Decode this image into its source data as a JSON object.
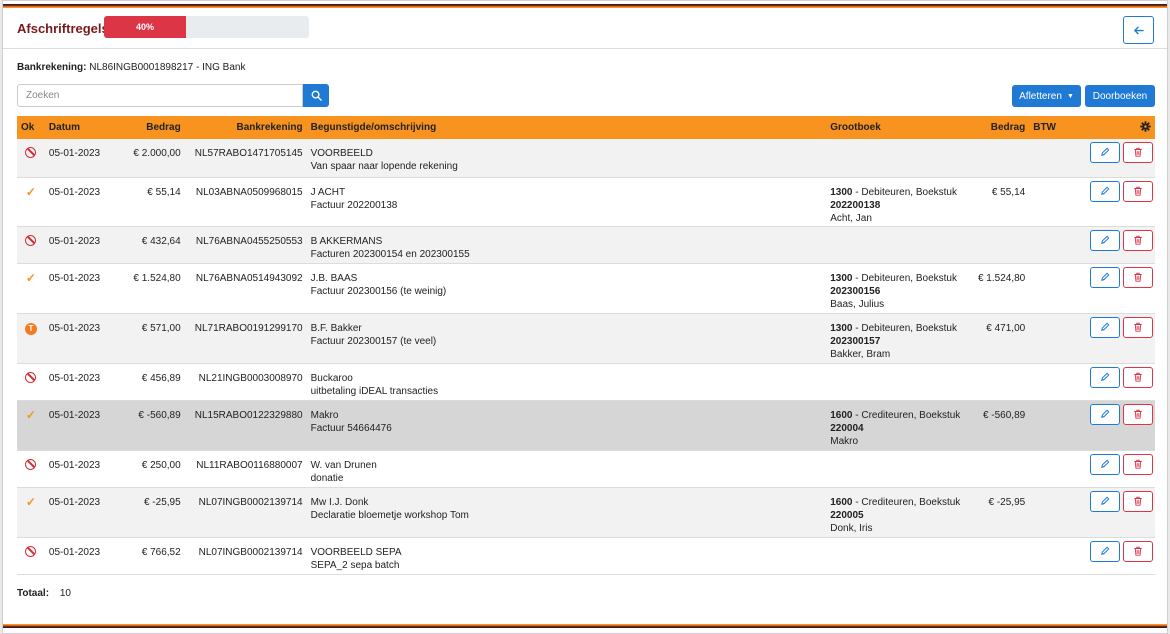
{
  "header": {
    "title": "Afschriftregels",
    "progress_label": "40%",
    "progress_value": 0.4,
    "back_icon": "arrow-left-icon"
  },
  "bank": {
    "label": "Bankrekening:",
    "value": "NL86INGB0001898217 - ING Bank"
  },
  "search": {
    "placeholder": "Zoeken",
    "value": ""
  },
  "toolbar": {
    "afletteren_label": "Afletteren",
    "doorboeken_label": "Doorboeken"
  },
  "table": {
    "headers": {
      "ok": "Ok",
      "datum": "Datum",
      "bedrag": "Bedrag",
      "bankrekening": "Bankrekening",
      "begunstigde": "Begunstigde/omschrijving",
      "grootboek": "Grootboek",
      "gb_bedrag": "Bedrag",
      "btw": "BTW"
    },
    "rows": [
      {
        "status": "blocked",
        "datum": "05-01-2023",
        "bedrag": "€ 2.000,00",
        "bankrekening": "NL57RABO1471705145",
        "naam": "VOORBEELD",
        "omschrijving": "Van spaar naar lopende rekening",
        "gb_code": "",
        "gb_naam": "",
        "gb_ref": "",
        "gb_relatie": "",
        "gb_bedrag": ""
      },
      {
        "status": "ok",
        "datum": "05-01-2023",
        "bedrag": "€ 55,14",
        "bankrekening": "NL03ABNA0509968015",
        "naam": "J ACHT",
        "omschrijving": "Factuur 202200138",
        "gb_code": "1300",
        "gb_naam": " - Debiteuren, Boekstuk",
        "gb_ref": "202200138",
        "gb_relatie": "Acht, Jan",
        "gb_bedrag": "€ 55,14"
      },
      {
        "status": "blocked",
        "datum": "05-01-2023",
        "bedrag": "€ 432,64",
        "bankrekening": "NL76ABNA0455250553",
        "naam": "B AKKERMANS",
        "omschrijving": "Facturen 202300154 en 202300155",
        "gb_code": "",
        "gb_naam": "",
        "gb_ref": "",
        "gb_relatie": "",
        "gb_bedrag": ""
      },
      {
        "status": "ok",
        "datum": "05-01-2023",
        "bedrag": "€ 1.524,80",
        "bankrekening": "NL76ABNA0514943092",
        "naam": "J.B. BAAS",
        "omschrijving": "Factuur 202300156 (te weinig)",
        "gb_code": "1300",
        "gb_naam": " - Debiteuren, Boekstuk",
        "gb_ref": "202300156",
        "gb_relatie": "Baas, Julius",
        "gb_bedrag": "€ 1.524,80"
      },
      {
        "status": "warning",
        "status_text": "T",
        "datum": "05-01-2023",
        "bedrag": "€ 571,00",
        "bankrekening": "NL71RABO0191299170",
        "naam": "B.F. Bakker",
        "omschrijving": "Factuur 202300157 (te veel)",
        "gb_code": "1300",
        "gb_naam": " - Debiteuren, Boekstuk",
        "gb_ref": "202300157",
        "gb_relatie": "Bakker, Bram",
        "gb_bedrag": "€ 471,00"
      },
      {
        "status": "blocked",
        "datum": "05-01-2023",
        "bedrag": "€ 456,89",
        "bankrekening": "NL21INGB0003008970",
        "naam": "Buckaroo",
        "omschrijving": "uitbetaling iDEAL transacties",
        "gb_code": "",
        "gb_naam": "",
        "gb_ref": "",
        "gb_relatie": "",
        "gb_bedrag": ""
      },
      {
        "status": "ok",
        "datum": "05-01-2023",
        "bedrag": "€ -560,89",
        "bankrekening": "NL15RABO0122329880",
        "naam": "Makro",
        "omschrijving": "Factuur 54664476",
        "gb_code": "1600",
        "gb_naam": " - Crediteuren, Boekstuk",
        "gb_ref": "220004",
        "gb_relatie": "Makro",
        "gb_bedrag": "€ -560,89"
      },
      {
        "status": "blocked",
        "datum": "05-01-2023",
        "bedrag": "€ 250,00",
        "bankrekening": "NL11RABO0116880007",
        "naam": "W. van Drunen",
        "omschrijving": "donatie",
        "gb_code": "",
        "gb_naam": "",
        "gb_ref": "",
        "gb_relatie": "",
        "gb_bedrag": ""
      },
      {
        "status": "ok",
        "datum": "05-01-2023",
        "bedrag": "€ -25,95",
        "bankrekening": "NL07INGB0002139714",
        "naam": "Mw I.J. Donk",
        "omschrijving": "Declaratie bloemetje workshop Tom",
        "gb_code": "1600",
        "gb_naam": " - Crediteuren, Boekstuk",
        "gb_ref": "220005",
        "gb_relatie": "Donk, Iris",
        "gb_bedrag": "€ -25,95"
      },
      {
        "status": "blocked",
        "datum": "05-01-2023",
        "bedrag": "€ 766,52",
        "bankrekening": "NL07INGB0002139714",
        "naam": "VOORBEELD SEPA",
        "omschrijving": "SEPA_2 sepa batch",
        "gb_code": "",
        "gb_naam": "",
        "gb_ref": "",
        "gb_relatie": "",
        "gb_bedrag": ""
      }
    ]
  },
  "footer": {
    "total_label": "Totaal:",
    "total_value": "10"
  },
  "colors": {
    "accent_orange": "#f7931e",
    "primary_blue": "#1f7ad6",
    "danger_red": "#dc3545",
    "title_red": "#7a1a1a"
  }
}
